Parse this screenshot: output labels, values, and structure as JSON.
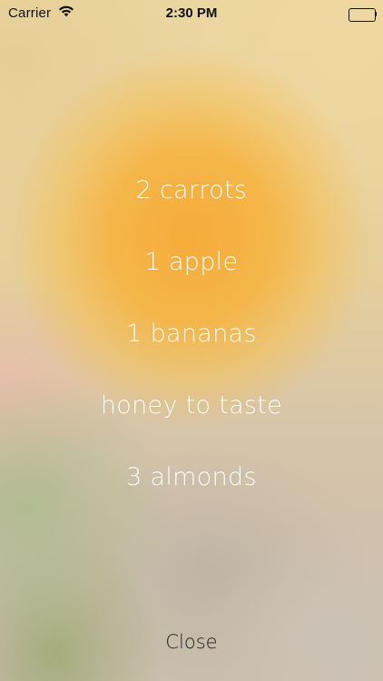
{
  "status_bar": {
    "carrier": "Carrier",
    "time": "2:30 PM",
    "wifi_icon": "wifi-icon",
    "battery_icon": "battery-icon",
    "battery_level": 1.0
  },
  "ingredients": [
    {
      "label": "2 carrots"
    },
    {
      "label": "1 apple"
    },
    {
      "label": "1 bananas"
    },
    {
      "label": "honey to taste"
    },
    {
      "label": "3 almonds"
    }
  ],
  "close_label": "Close",
  "colors": {
    "text": "#ffffff",
    "close_text": "#1e1e1e",
    "orange_glow": "#f6aa34"
  }
}
